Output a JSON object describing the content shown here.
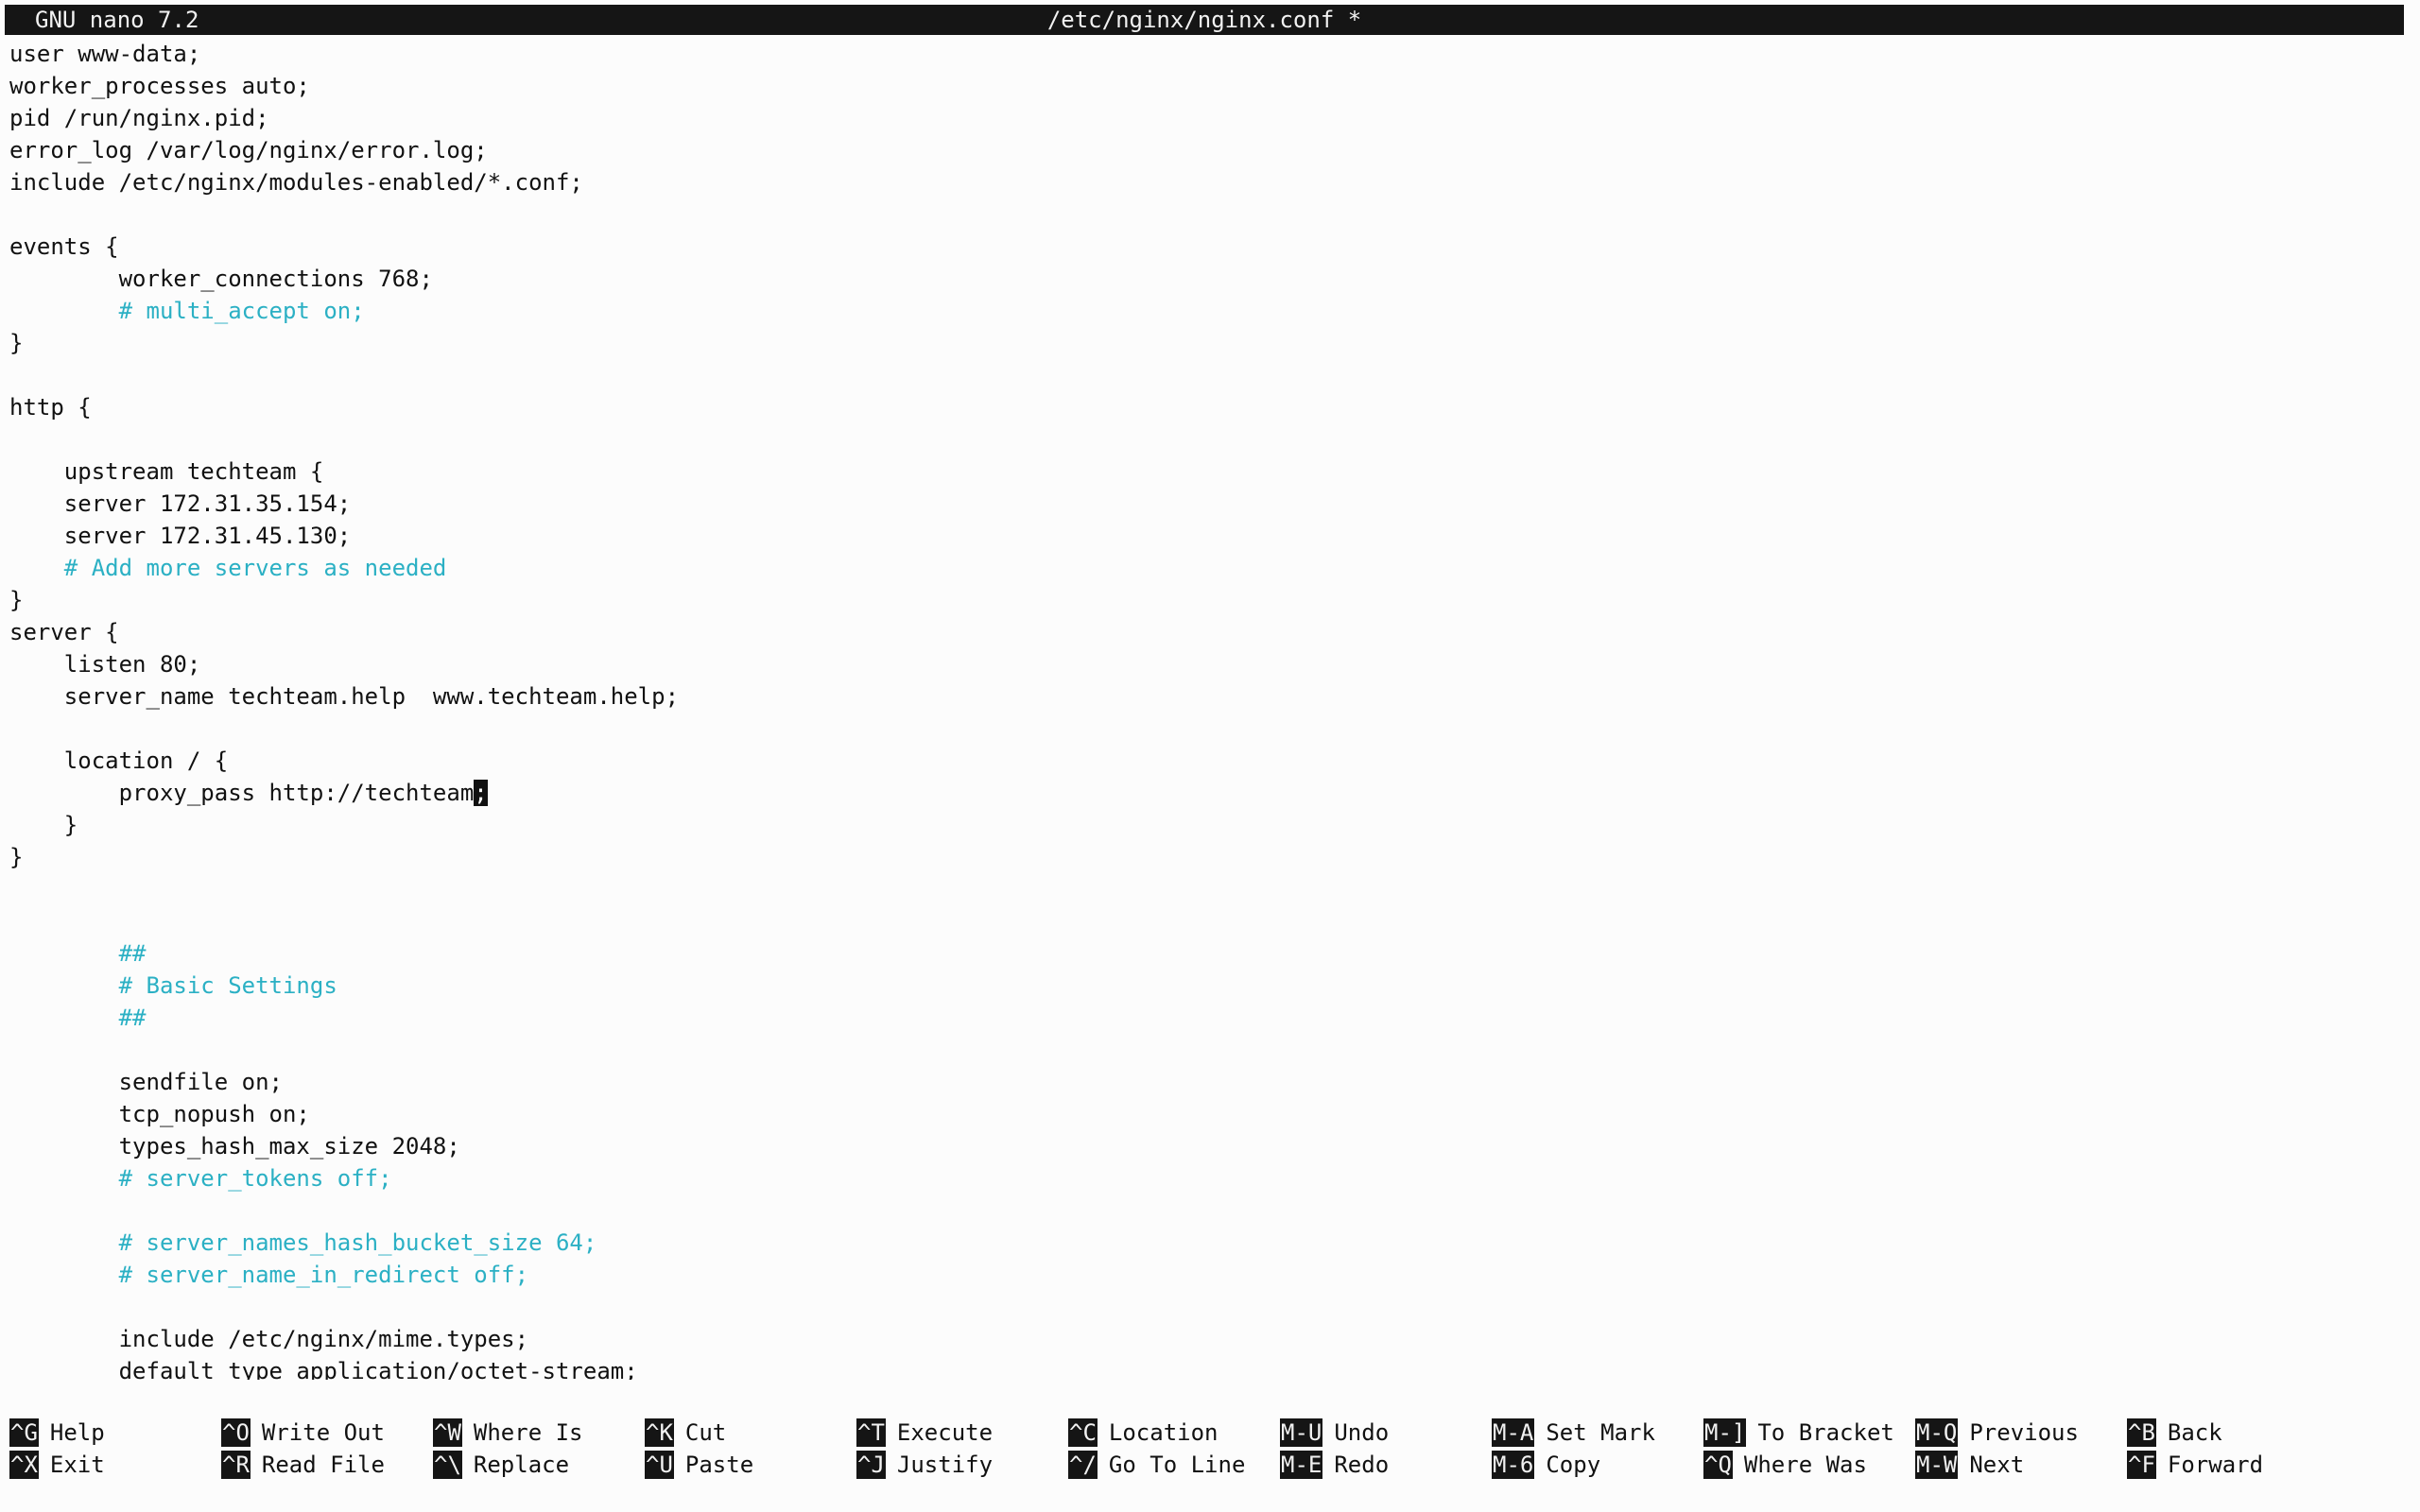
{
  "titlebar": {
    "app": "GNU nano 7.2",
    "file": "/etc/nginx/nginx.conf *"
  },
  "editor": {
    "lines": [
      {
        "text": "user www-data;",
        "type": "code"
      },
      {
        "text": "worker_processes auto;",
        "type": "code"
      },
      {
        "text": "pid /run/nginx.pid;",
        "type": "code"
      },
      {
        "text": "error_log /var/log/nginx/error.log;",
        "type": "code"
      },
      {
        "text": "include /etc/nginx/modules-enabled/*.conf;",
        "type": "code"
      },
      {
        "text": "",
        "type": "code"
      },
      {
        "text": "events {",
        "type": "code"
      },
      {
        "text": "        worker_connections 768;",
        "type": "code"
      },
      {
        "text": "        # multi_accept on;",
        "type": "comment"
      },
      {
        "text": "}",
        "type": "code"
      },
      {
        "text": "",
        "type": "code"
      },
      {
        "text": "http {",
        "type": "code"
      },
      {
        "text": "",
        "type": "code"
      },
      {
        "text": "    upstream techteam {",
        "type": "code"
      },
      {
        "text": "    server 172.31.35.154;",
        "type": "code"
      },
      {
        "text": "    server 172.31.45.130;",
        "type": "code"
      },
      {
        "text": "    # Add more servers as needed",
        "type": "comment"
      },
      {
        "text": "}",
        "type": "code"
      },
      {
        "text": "server {",
        "type": "code"
      },
      {
        "text": "    listen 80;",
        "type": "code"
      },
      {
        "text": "    server_name techteam.help  www.techteam.help;",
        "type": "code"
      },
      {
        "text": "",
        "type": "code"
      },
      {
        "text": "    location / {",
        "type": "code"
      },
      {
        "text": "        proxy_pass http://techteam",
        "type": "code",
        "cursor": ";"
      },
      {
        "text": "    }",
        "type": "code"
      },
      {
        "text": "}",
        "type": "code"
      },
      {
        "text": "",
        "type": "code"
      },
      {
        "text": "",
        "type": "code"
      },
      {
        "text": "        ##",
        "type": "comment"
      },
      {
        "text": "        # Basic Settings",
        "type": "comment"
      },
      {
        "text": "        ##",
        "type": "comment"
      },
      {
        "text": "",
        "type": "code"
      },
      {
        "text": "        sendfile on;",
        "type": "code"
      },
      {
        "text": "        tcp_nopush on;",
        "type": "code"
      },
      {
        "text": "        types_hash_max_size 2048;",
        "type": "code"
      },
      {
        "text": "        # server_tokens off;",
        "type": "comment"
      },
      {
        "text": "",
        "type": "code"
      },
      {
        "text": "        # server_names_hash_bucket_size 64;",
        "type": "comment"
      },
      {
        "text": "        # server_name_in_redirect off;",
        "type": "comment"
      },
      {
        "text": "",
        "type": "code"
      },
      {
        "text": "        include /etc/nginx/mime.types;",
        "type": "code"
      },
      {
        "text": "        default_type application/octet-stream;",
        "type": "code"
      }
    ]
  },
  "shortcuts": {
    "row1": [
      {
        "key": "^G",
        "label": "Help"
      },
      {
        "key": "^O",
        "label": "Write Out"
      },
      {
        "key": "^W",
        "label": "Where Is"
      },
      {
        "key": "^K",
        "label": "Cut"
      },
      {
        "key": "^T",
        "label": "Execute"
      },
      {
        "key": "^C",
        "label": "Location"
      },
      {
        "key": "M-U",
        "label": "Undo"
      },
      {
        "key": "M-A",
        "label": "Set Mark"
      },
      {
        "key": "M-]",
        "label": "To Bracket"
      },
      {
        "key": "M-Q",
        "label": "Previous"
      },
      {
        "key": "^B",
        "label": "Back"
      }
    ],
    "row2": [
      {
        "key": "^X",
        "label": "Exit"
      },
      {
        "key": "^R",
        "label": "Read File"
      },
      {
        "key": "^\\",
        "label": "Replace"
      },
      {
        "key": "^U",
        "label": "Paste"
      },
      {
        "key": "^J",
        "label": "Justify"
      },
      {
        "key": "^/",
        "label": "Go To Line"
      },
      {
        "key": "M-E",
        "label": "Redo"
      },
      {
        "key": "M-6",
        "label": "Copy"
      },
      {
        "key": "^Q",
        "label": "Where Was"
      },
      {
        "key": "M-W",
        "label": "Next"
      },
      {
        "key": "^F",
        "label": "Forward"
      }
    ]
  },
  "colors": {
    "comment": "#2bb0c4",
    "bar_background": "#151515",
    "background": "#fcfcfc"
  }
}
